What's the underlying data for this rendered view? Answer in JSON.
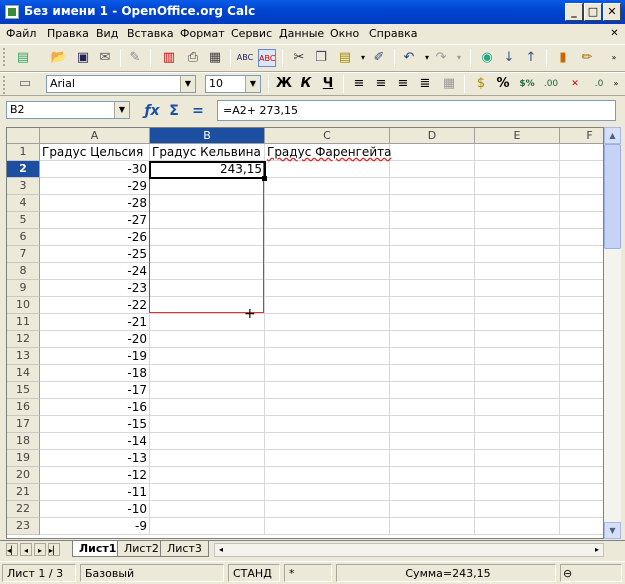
{
  "window": {
    "title": "Без имени 1 - OpenOffice.org Calc"
  },
  "menu": [
    "Файл",
    "Правка",
    "Вид",
    "Вставка",
    "Формат",
    "Сервис",
    "Данные",
    "Окно",
    "Справка"
  ],
  "font": {
    "name": "Arial",
    "size": "10"
  },
  "toolbar2_labels": {
    "bold": "Ж",
    "italic": "К",
    "underline": "Ч"
  },
  "name_box": "B2",
  "formula": "=A2+ 273,15",
  "columns": [
    "A",
    "B",
    "C",
    "D",
    "E",
    "F"
  ],
  "rows": [
    "1",
    "2",
    "3",
    "4",
    "5",
    "6",
    "7",
    "8",
    "9",
    "10",
    "11",
    "12",
    "13",
    "14",
    "15",
    "16",
    "17",
    "18",
    "19",
    "20",
    "21",
    "22",
    "23"
  ],
  "cells": {
    "A1": "Градус Цельсия",
    "B1": "Градус Кельвина",
    "C1": "Градус Фаренгейта",
    "B2": "243,15",
    "A": [
      "-30",
      "-29",
      "-28",
      "-27",
      "-26",
      "-25",
      "-24",
      "-23",
      "-22",
      "-21",
      "-20",
      "-19",
      "-18",
      "-17",
      "-16",
      "-15",
      "-14",
      "-13",
      "-12",
      "-11",
      "-10",
      "-9"
    ]
  },
  "tabs": [
    "Лист1",
    "Лист2",
    "Лист3"
  ],
  "status": {
    "sheet": "Лист 1 / 3",
    "style": "Базовый",
    "mode": "СТАНД",
    "modified": "*",
    "sum": "Сумма=243,15"
  }
}
